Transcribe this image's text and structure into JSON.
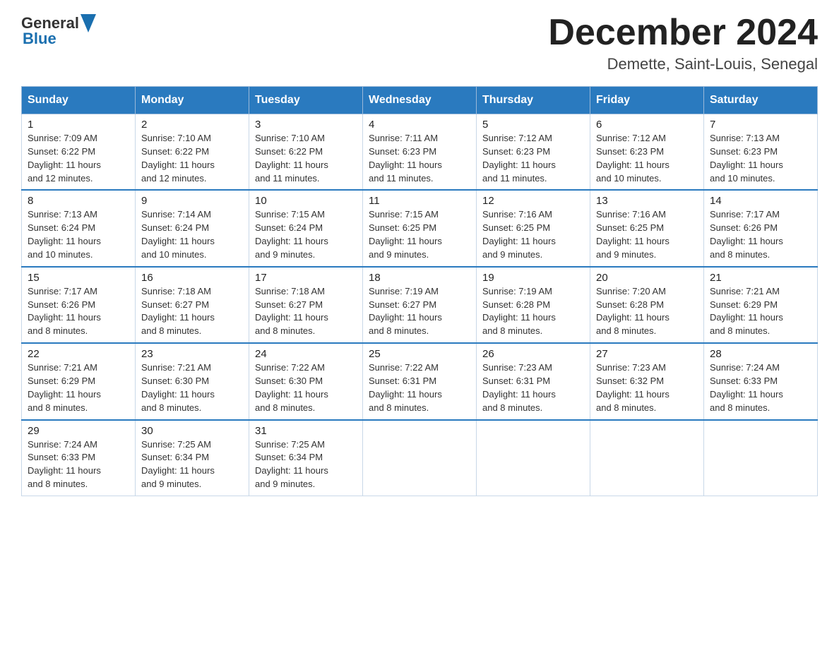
{
  "header": {
    "logo_general": "General",
    "logo_blue": "Blue",
    "month_title": "December 2024",
    "location": "Demette, Saint-Louis, Senegal"
  },
  "days_of_week": [
    "Sunday",
    "Monday",
    "Tuesday",
    "Wednesday",
    "Thursday",
    "Friday",
    "Saturday"
  ],
  "weeks": [
    [
      {
        "day": "1",
        "sunrise": "7:09 AM",
        "sunset": "6:22 PM",
        "daylight": "11 hours and 12 minutes."
      },
      {
        "day": "2",
        "sunrise": "7:10 AM",
        "sunset": "6:22 PM",
        "daylight": "11 hours and 12 minutes."
      },
      {
        "day": "3",
        "sunrise": "7:10 AM",
        "sunset": "6:22 PM",
        "daylight": "11 hours and 11 minutes."
      },
      {
        "day": "4",
        "sunrise": "7:11 AM",
        "sunset": "6:23 PM",
        "daylight": "11 hours and 11 minutes."
      },
      {
        "day": "5",
        "sunrise": "7:12 AM",
        "sunset": "6:23 PM",
        "daylight": "11 hours and 11 minutes."
      },
      {
        "day": "6",
        "sunrise": "7:12 AM",
        "sunset": "6:23 PM",
        "daylight": "11 hours and 10 minutes."
      },
      {
        "day": "7",
        "sunrise": "7:13 AM",
        "sunset": "6:23 PM",
        "daylight": "11 hours and 10 minutes."
      }
    ],
    [
      {
        "day": "8",
        "sunrise": "7:13 AM",
        "sunset": "6:24 PM",
        "daylight": "11 hours and 10 minutes."
      },
      {
        "day": "9",
        "sunrise": "7:14 AM",
        "sunset": "6:24 PM",
        "daylight": "11 hours and 10 minutes."
      },
      {
        "day": "10",
        "sunrise": "7:15 AM",
        "sunset": "6:24 PM",
        "daylight": "11 hours and 9 minutes."
      },
      {
        "day": "11",
        "sunrise": "7:15 AM",
        "sunset": "6:25 PM",
        "daylight": "11 hours and 9 minutes."
      },
      {
        "day": "12",
        "sunrise": "7:16 AM",
        "sunset": "6:25 PM",
        "daylight": "11 hours and 9 minutes."
      },
      {
        "day": "13",
        "sunrise": "7:16 AM",
        "sunset": "6:25 PM",
        "daylight": "11 hours and 9 minutes."
      },
      {
        "day": "14",
        "sunrise": "7:17 AM",
        "sunset": "6:26 PM",
        "daylight": "11 hours and 8 minutes."
      }
    ],
    [
      {
        "day": "15",
        "sunrise": "7:17 AM",
        "sunset": "6:26 PM",
        "daylight": "11 hours and 8 minutes."
      },
      {
        "day": "16",
        "sunrise": "7:18 AM",
        "sunset": "6:27 PM",
        "daylight": "11 hours and 8 minutes."
      },
      {
        "day": "17",
        "sunrise": "7:18 AM",
        "sunset": "6:27 PM",
        "daylight": "11 hours and 8 minutes."
      },
      {
        "day": "18",
        "sunrise": "7:19 AM",
        "sunset": "6:27 PM",
        "daylight": "11 hours and 8 minutes."
      },
      {
        "day": "19",
        "sunrise": "7:19 AM",
        "sunset": "6:28 PM",
        "daylight": "11 hours and 8 minutes."
      },
      {
        "day": "20",
        "sunrise": "7:20 AM",
        "sunset": "6:28 PM",
        "daylight": "11 hours and 8 minutes."
      },
      {
        "day": "21",
        "sunrise": "7:21 AM",
        "sunset": "6:29 PM",
        "daylight": "11 hours and 8 minutes."
      }
    ],
    [
      {
        "day": "22",
        "sunrise": "7:21 AM",
        "sunset": "6:29 PM",
        "daylight": "11 hours and 8 minutes."
      },
      {
        "day": "23",
        "sunrise": "7:21 AM",
        "sunset": "6:30 PM",
        "daylight": "11 hours and 8 minutes."
      },
      {
        "day": "24",
        "sunrise": "7:22 AM",
        "sunset": "6:30 PM",
        "daylight": "11 hours and 8 minutes."
      },
      {
        "day": "25",
        "sunrise": "7:22 AM",
        "sunset": "6:31 PM",
        "daylight": "11 hours and 8 minutes."
      },
      {
        "day": "26",
        "sunrise": "7:23 AM",
        "sunset": "6:31 PM",
        "daylight": "11 hours and 8 minutes."
      },
      {
        "day": "27",
        "sunrise": "7:23 AM",
        "sunset": "6:32 PM",
        "daylight": "11 hours and 8 minutes."
      },
      {
        "day": "28",
        "sunrise": "7:24 AM",
        "sunset": "6:33 PM",
        "daylight": "11 hours and 8 minutes."
      }
    ],
    [
      {
        "day": "29",
        "sunrise": "7:24 AM",
        "sunset": "6:33 PM",
        "daylight": "11 hours and 8 minutes."
      },
      {
        "day": "30",
        "sunrise": "7:25 AM",
        "sunset": "6:34 PM",
        "daylight": "11 hours and 9 minutes."
      },
      {
        "day": "31",
        "sunrise": "7:25 AM",
        "sunset": "6:34 PM",
        "daylight": "11 hours and 9 minutes."
      },
      null,
      null,
      null,
      null
    ]
  ],
  "labels": {
    "sunrise": "Sunrise:",
    "sunset": "Sunset:",
    "daylight": "Daylight:"
  }
}
